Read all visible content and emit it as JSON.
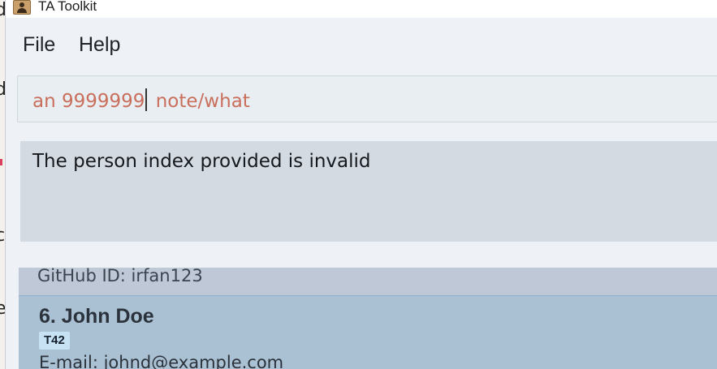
{
  "window": {
    "title": "TA Toolkit",
    "icon": "address-book-icon"
  },
  "menu": {
    "items": [
      {
        "label": "File"
      },
      {
        "label": "Help"
      }
    ]
  },
  "command_box": {
    "value_before_caret": "an 9999999",
    "value_after_caret": " note/what",
    "text_color": "#c96f5c"
  },
  "result_display": {
    "message": "The person index provided is invalid"
  },
  "person_list": {
    "previous_card": {
      "github": "GitHub ID: irfan123"
    },
    "selected_card": {
      "index_name": "6.  John Doe",
      "tags": [
        "T42"
      ],
      "email": "E-mail: johnd@example.com"
    }
  },
  "colors": {
    "window_bg": "#eef1f5",
    "result_bg": "#d4dae2",
    "selected_card_bg": "#aac1d3",
    "tag_bg": "#c7e3f3"
  }
}
